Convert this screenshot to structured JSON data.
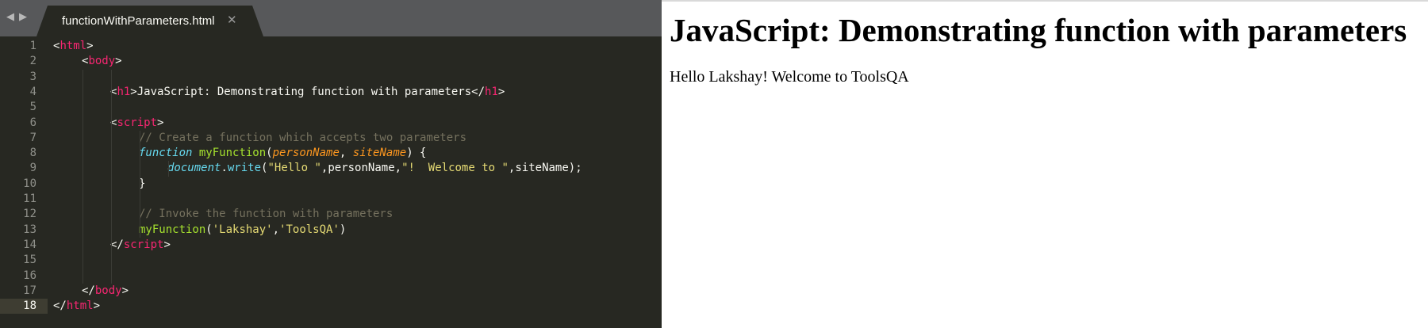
{
  "editor": {
    "tab": {
      "title": "functionWithParameters.html",
      "close_glyph": "✕"
    },
    "nav": {
      "back_glyph": "◀",
      "forward_glyph": "▶"
    },
    "active_line": 18,
    "lines": [
      {
        "n": "1",
        "indent": 0,
        "tokens": [
          [
            "<",
            "plain"
          ],
          [
            "html",
            "tag"
          ],
          [
            ">",
            "plain"
          ]
        ]
      },
      {
        "n": "2",
        "indent": 1,
        "tokens": [
          [
            "<",
            "plain"
          ],
          [
            "body",
            "tag"
          ],
          [
            ">",
            "plain"
          ]
        ]
      },
      {
        "n": "3",
        "indent": 0,
        "tokens": []
      },
      {
        "n": "4",
        "indent": 2,
        "tokens": [
          [
            "<",
            "plain"
          ],
          [
            "h1",
            "tag"
          ],
          [
            ">JavaScript: Demonstrating function with parameters</",
            "plain"
          ],
          [
            "h1",
            "tag"
          ],
          [
            ">",
            "plain"
          ]
        ]
      },
      {
        "n": "5",
        "indent": 0,
        "tokens": []
      },
      {
        "n": "6",
        "indent": 2,
        "tokens": [
          [
            "<",
            "plain"
          ],
          [
            "script",
            "tag"
          ],
          [
            ">",
            "plain"
          ]
        ]
      },
      {
        "n": "7",
        "indent": 3,
        "tokens": [
          [
            "// Create a function which accepts two parameters",
            "comment"
          ]
        ]
      },
      {
        "n": "8",
        "indent": 3,
        "tokens": [
          [
            "function",
            "storage"
          ],
          [
            " ",
            "plain"
          ],
          [
            "myFunction",
            "fn"
          ],
          [
            "(",
            "plain"
          ],
          [
            "personName",
            "param"
          ],
          [
            ", ",
            "plain"
          ],
          [
            "siteName",
            "param"
          ],
          [
            ") {",
            "plain"
          ]
        ]
      },
      {
        "n": "9",
        "indent": 4,
        "tokens": [
          [
            "document",
            "support"
          ],
          [
            ".",
            "plain"
          ],
          [
            "write",
            "method"
          ],
          [
            "(",
            "plain"
          ],
          [
            "\"Hello \"",
            "str"
          ],
          [
            ",personName,",
            "plain"
          ],
          [
            "\"!  Welcome to \"",
            "str"
          ],
          [
            ",siteName);",
            "plain"
          ]
        ]
      },
      {
        "n": "10",
        "indent": 3,
        "tokens": [
          [
            "}",
            "plain"
          ]
        ]
      },
      {
        "n": "11",
        "indent": 0,
        "tokens": []
      },
      {
        "n": "12",
        "indent": 3,
        "tokens": [
          [
            "// Invoke the function with parameters",
            "comment"
          ]
        ]
      },
      {
        "n": "13",
        "indent": 3,
        "tokens": [
          [
            "myFunction",
            "fn"
          ],
          [
            "(",
            "plain"
          ],
          [
            "'Lakshay'",
            "str"
          ],
          [
            ",",
            "plain"
          ],
          [
            "'ToolsQA'",
            "str"
          ],
          [
            ")",
            "plain"
          ]
        ]
      },
      {
        "n": "14",
        "indent": 2,
        "tokens": [
          [
            "</",
            "plain"
          ],
          [
            "script",
            "tag"
          ],
          [
            ">",
            "plain"
          ]
        ]
      },
      {
        "n": "15",
        "indent": 0,
        "tokens": []
      },
      {
        "n": "16",
        "indent": 0,
        "tokens": []
      },
      {
        "n": "17",
        "indent": 1,
        "tokens": [
          [
            "</",
            "plain"
          ],
          [
            "body",
            "tag"
          ],
          [
            ">",
            "plain"
          ]
        ]
      },
      {
        "n": "18",
        "indent": 0,
        "tokens": [
          [
            "</",
            "plain"
          ],
          [
            "html",
            "tag"
          ],
          [
            ">",
            "plain"
          ]
        ]
      }
    ]
  },
  "browser": {
    "heading": "JavaScript: Demonstrating function with parameters",
    "output": "Hello Lakshay! Welcome to ToolsQA"
  },
  "colors": {
    "editor_bg": "#272822",
    "tabbar_bg": "#57585a",
    "tag": "#f92672",
    "comment": "#75715e",
    "storage": "#66d9ef",
    "function_name": "#a6e22e",
    "parameter": "#fd971f",
    "string": "#e6db74"
  }
}
